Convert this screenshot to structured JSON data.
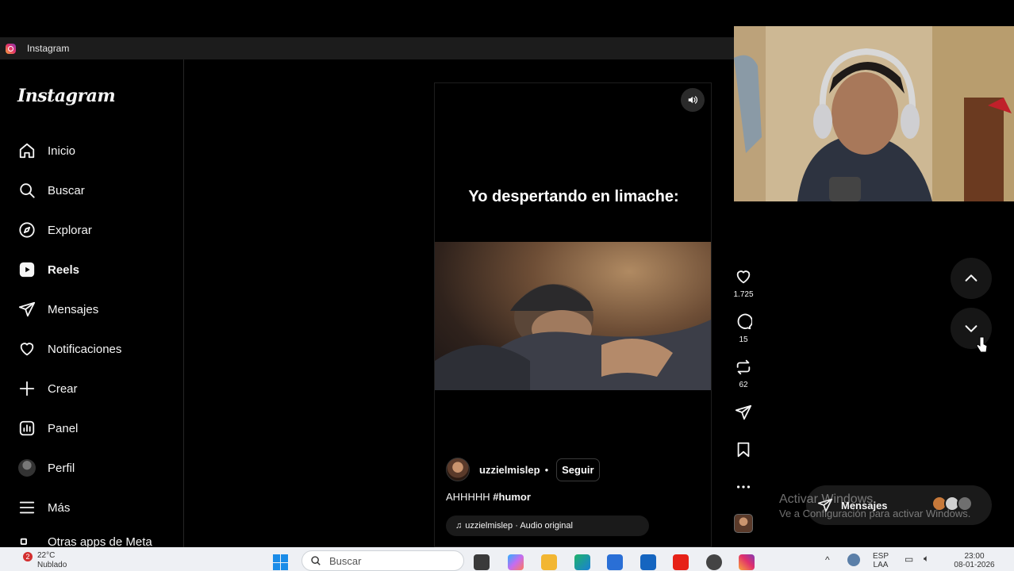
{
  "window": {
    "title": "Instagram"
  },
  "sidebar": {
    "logo": "Instagram",
    "items": [
      {
        "label": "Inicio",
        "icon": "home-icon"
      },
      {
        "label": "Buscar",
        "icon": "search-icon"
      },
      {
        "label": "Explorar",
        "icon": "compass-icon"
      },
      {
        "label": "Reels",
        "icon": "reels-icon",
        "active": true
      },
      {
        "label": "Mensajes",
        "icon": "send-icon"
      },
      {
        "label": "Notificaciones",
        "icon": "heart-icon"
      },
      {
        "label": "Crear",
        "icon": "plus-icon"
      },
      {
        "label": "Panel",
        "icon": "chart-icon"
      },
      {
        "label": "Perfil",
        "icon": "profile-avatar"
      },
      {
        "label": "Más",
        "icon": "menu-icon"
      },
      {
        "label": "Otras apps de Meta",
        "icon": "meta-icon"
      }
    ]
  },
  "reel": {
    "caption_overlay": "Yo despertando en limache:",
    "author": "uzzielmislep",
    "follow_label": "Seguir",
    "description_text": "AHHHHH ",
    "hashtag": "#humor",
    "audio": "uzzielmislep · Audio original"
  },
  "actions": {
    "likes": "1.725",
    "comments": "15",
    "reposts": "62"
  },
  "messages_bar": {
    "label": "Mensajes"
  },
  "watermark": {
    "line1": "Activar Windows",
    "line2": "Ve a Configuración para activar Windows."
  },
  "taskbar": {
    "weather_temp": "22°C",
    "weather_desc": "Nublado",
    "notif_count": "2",
    "search_placeholder": "Buscar",
    "lang_line1": "ESP",
    "lang_line2": "LAA",
    "time": "23:00",
    "date": "08-01-2026"
  },
  "colors": {
    "background": "#000000",
    "sidebar_border": "#262626",
    "taskbar": "#eef0f4",
    "instagram_gradient": [
      "#f9a53a",
      "#e1306c",
      "#833ab4"
    ]
  }
}
